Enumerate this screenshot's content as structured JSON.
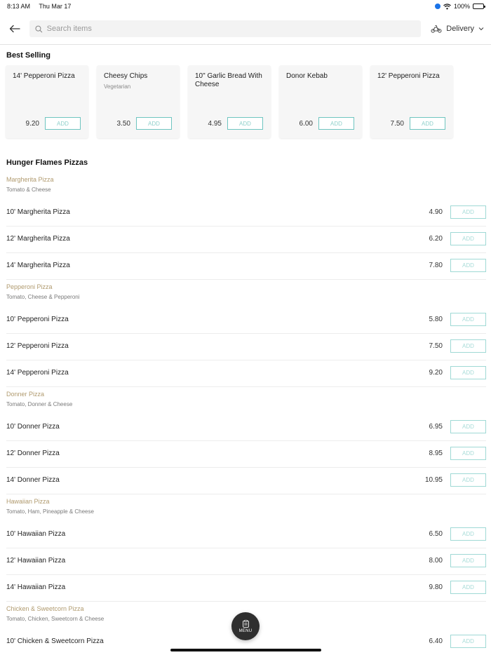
{
  "status_bar": {
    "time": "8:13 AM",
    "date": "Thu Mar 17",
    "battery": "100%"
  },
  "header": {
    "search_placeholder": "Search items",
    "delivery_label": "Delivery"
  },
  "best_selling": {
    "title": "Best Selling",
    "items": [
      {
        "name": "14' Pepperoni Pizza",
        "sub": "",
        "price": "9.20",
        "add": "ADD"
      },
      {
        "name": "Cheesy Chips",
        "sub": "Vegetarian",
        "price": "3.50",
        "add": "ADD"
      },
      {
        "name": "10\" Garlic Bread With Cheese",
        "sub": "",
        "price": "4.95",
        "add": "ADD"
      },
      {
        "name": "Donor Kebab",
        "sub": "",
        "price": "6.00",
        "add": "ADD"
      },
      {
        "name": "12' Pepperoni Pizza",
        "sub": "",
        "price": "7.50",
        "add": "ADD"
      }
    ]
  },
  "menu": {
    "title": "Hunger Flames Pizzas",
    "categories": [
      {
        "name": "Margherita Pizza",
        "desc": "Tomato & Cheese",
        "items": [
          {
            "name": "10' Margherita Pizza",
            "price": "4.90",
            "add": "ADD"
          },
          {
            "name": "12' Margherita Pizza",
            "price": "6.20",
            "add": "ADD"
          },
          {
            "name": "14' Margherita Pizza",
            "price": "7.80",
            "add": "ADD"
          }
        ]
      },
      {
        "name": "Pepperoni Pizza",
        "desc": "Tomato, Cheese & Pepperoni",
        "items": [
          {
            "name": "10' Pepperoni Pizza",
            "price": "5.80",
            "add": "ADD"
          },
          {
            "name": "12' Pepperoni Pizza",
            "price": "7.50",
            "add": "ADD"
          },
          {
            "name": "14' Pepperoni Pizza",
            "price": "9.20",
            "add": "ADD"
          }
        ]
      },
      {
        "name": "Donner Pizza",
        "desc": "Tomato, Donner & Cheese",
        "items": [
          {
            "name": "10' Donner Pizza",
            "price": "6.95",
            "add": "ADD"
          },
          {
            "name": "12' Donner Pizza",
            "price": "8.95",
            "add": "ADD"
          },
          {
            "name": "14' Donner Pizza",
            "price": "10.95",
            "add": "ADD"
          }
        ]
      },
      {
        "name": "Hawaiian Pizza",
        "desc": "Tomato, Ham, Pineapple & Cheese",
        "items": [
          {
            "name": "10' Hawaiian Pizza",
            "price": "6.50",
            "add": "ADD"
          },
          {
            "name": "12' Hawaiian Pizza",
            "price": "8.00",
            "add": "ADD"
          },
          {
            "name": "14' Hawaiian Pizza",
            "price": "9.80",
            "add": "ADD"
          }
        ]
      },
      {
        "name": "Chicken & Sweetcorn Pizza",
        "desc": "Tomato, Chicken, Sweetcorn & Cheese",
        "items": [
          {
            "name": "10' Chicken & Sweetcorn Pizza",
            "price": "6.40",
            "add": "ADD"
          }
        ]
      }
    ]
  },
  "fab": {
    "label": "MENU"
  },
  "colors": {
    "accent_teal": "#6fc5c0",
    "category_gold": "#b09a6e"
  }
}
